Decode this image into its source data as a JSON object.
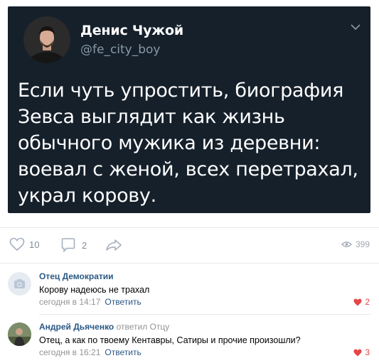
{
  "tweet": {
    "author_name": "Денис Чужой",
    "handle": "@fe_city_boy",
    "text": "Если чуть упростить, биография Зевса выглядит как жизнь обычного мужика из деревни: воевал с женой, всех перетрахал, украл корову."
  },
  "actions": {
    "likes": "10",
    "comments": "2",
    "views": "399",
    "icons": [
      "heart-icon",
      "comment-icon",
      "share-icon",
      "eye-icon"
    ]
  },
  "comments": [
    {
      "author": "Отец Демократии",
      "reply_to": "",
      "text": "Корову надеюсь не трахал",
      "time": "сегодня в 14:17",
      "reply_label": "Ответить",
      "likes": "2"
    },
    {
      "author": "Андрей Дьяченко",
      "reply_to": "ответил Отцу",
      "text": "Отец, а как по твоему Кентавры, Сатиры и прочие произошли?",
      "time": "сегодня в 16:21",
      "reply_label": "Ответить",
      "likes": "3"
    }
  ],
  "colors": {
    "tweet_bg": "#15202b",
    "link": "#2a5885",
    "like_active": "#e64646",
    "muted": "#939393"
  }
}
